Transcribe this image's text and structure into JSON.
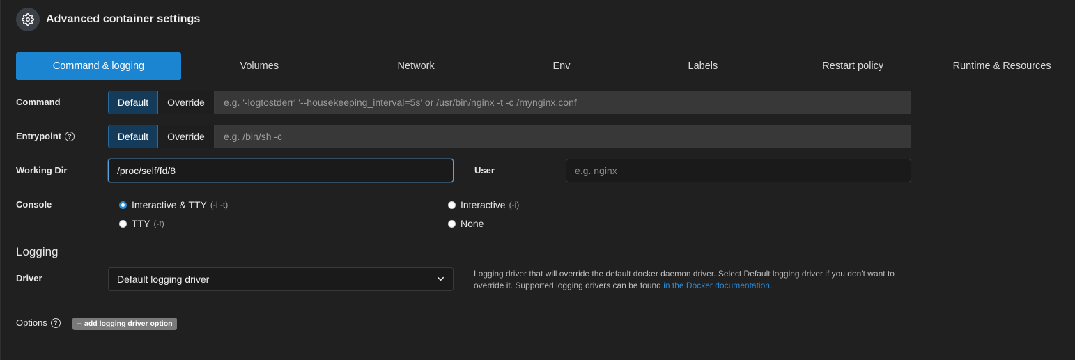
{
  "header": {
    "title": "Advanced container settings",
    "icon": "gear-icon"
  },
  "tabs": [
    {
      "label": "Command & logging",
      "active": true
    },
    {
      "label": "Volumes",
      "active": false
    },
    {
      "label": "Network",
      "active": false
    },
    {
      "label": "Env",
      "active": false
    },
    {
      "label": "Labels",
      "active": false
    },
    {
      "label": "Restart policy",
      "active": false
    },
    {
      "label": "Runtime & Resources",
      "active": false
    }
  ],
  "command": {
    "label": "Command",
    "default_label": "Default",
    "override_label": "Override",
    "placeholder": "e.g. '-logtostderr' '--housekeeping_interval=5s' or /usr/bin/nginx -t -c /mynginx.conf"
  },
  "entrypoint": {
    "label": "Entrypoint",
    "help": "?",
    "default_label": "Default",
    "override_label": "Override",
    "placeholder": "e.g. /bin/sh -c"
  },
  "working_dir": {
    "label": "Working Dir",
    "value": "/proc/self/fd/8"
  },
  "user": {
    "label": "User",
    "placeholder": "e.g. nginx"
  },
  "console": {
    "label": "Console",
    "options": [
      {
        "label": "Interactive & TTY",
        "hint": "(-i -t)",
        "checked": true
      },
      {
        "label": "Interactive",
        "hint": "(-i)",
        "checked": false
      },
      {
        "label": "TTY",
        "hint": "(-t)",
        "checked": false
      },
      {
        "label": "None",
        "hint": "",
        "checked": false
      }
    ]
  },
  "logging": {
    "section_title": "Logging",
    "driver_label": "Driver",
    "driver_value": "Default logging driver",
    "help_text": "Logging driver that will override the default docker daemon driver. Select Default logging driver if you don't want to override it. Supported logging drivers can be found",
    "help_link": "in the Docker documentation",
    "help_end": ".",
    "options_label": "Options",
    "options_help": "?",
    "add_option_label": "add logging driver option"
  },
  "colors": {
    "accent": "#1b85d2",
    "background": "#202020"
  }
}
